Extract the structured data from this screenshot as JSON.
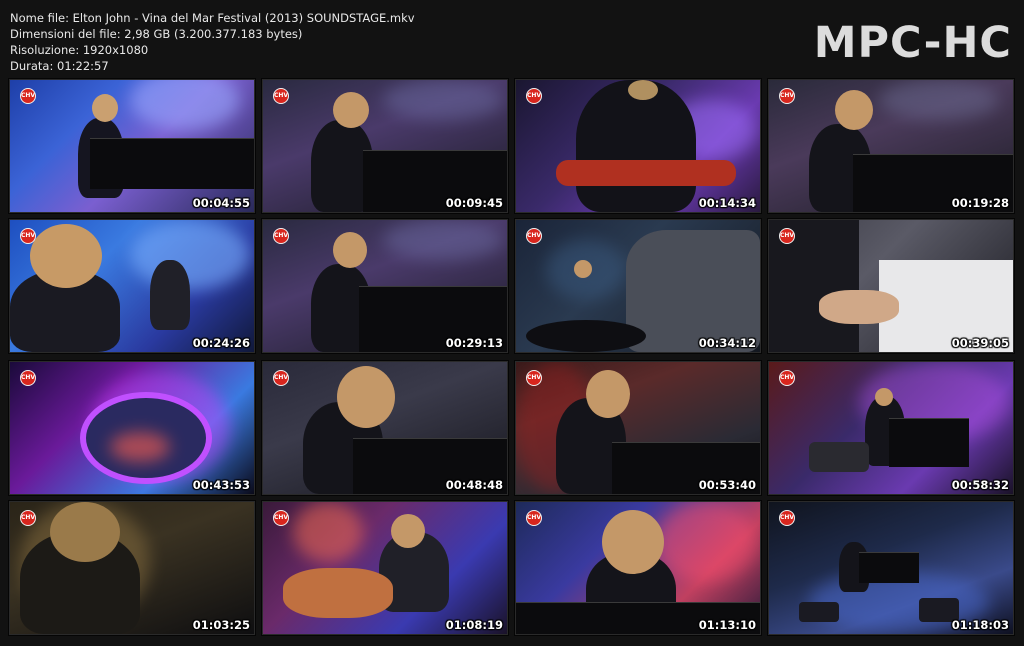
{
  "header": {
    "file_name": "Nome file: Elton John - Vina del Mar Festival (2013) SOUNDSTAGE.mkv",
    "file_size": "Dimensioni del file: 2,98 GB (3.200.377.183 bytes)",
    "resolution": "Risoluzione: 1920x1080",
    "duration": "Durata: 01:22:57",
    "brand": "MPC-HC"
  },
  "thumbnails": [
    {
      "timestamp": "00:04:55",
      "logo": "CHV"
    },
    {
      "timestamp": "00:09:45",
      "logo": "CHV"
    },
    {
      "timestamp": "00:14:34",
      "logo": "CHV"
    },
    {
      "timestamp": "00:19:28",
      "logo": "CHV"
    },
    {
      "timestamp": "00:24:26",
      "logo": "CHV"
    },
    {
      "timestamp": "00:29:13",
      "logo": "CHV"
    },
    {
      "timestamp": "00:34:12",
      "logo": "CHV"
    },
    {
      "timestamp": "00:39:05",
      "logo": "CHV"
    },
    {
      "timestamp": "00:43:53",
      "logo": "CHV"
    },
    {
      "timestamp": "00:48:48",
      "logo": "CHV"
    },
    {
      "timestamp": "00:53:40",
      "logo": "CHV"
    },
    {
      "timestamp": "00:58:32",
      "logo": "CHV"
    },
    {
      "timestamp": "01:03:25",
      "logo": "CHV"
    },
    {
      "timestamp": "01:08:19",
      "logo": "CHV"
    },
    {
      "timestamp": "01:13:10",
      "logo": "CHV"
    },
    {
      "timestamp": "01:18:03",
      "logo": "CHV"
    }
  ]
}
